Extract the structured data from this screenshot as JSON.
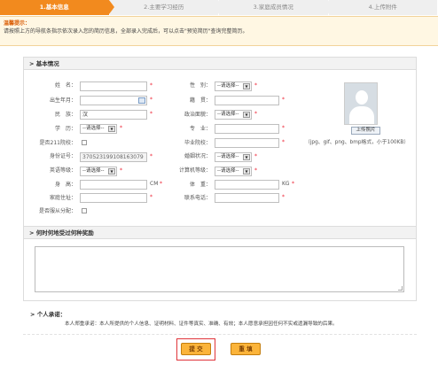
{
  "steps": [
    "1.基本信息",
    "2.主要学习经历",
    "3.家庭成员情况",
    "4.上传附件"
  ],
  "tip": {
    "title": "温馨提示：",
    "text": "请按照上方的导航条指示依次录入您的简历信息，全部录入完成后，可以点击\"预览简历\"查询完整简历。"
  },
  "basic": {
    "heading": "> 基本情况",
    "labels": {
      "name": "姓　名：",
      "birth": "出生年月：",
      "nation": "民　族：",
      "education": "学　历：",
      "is211": "是否211院校：",
      "idcard": "身份证号：",
      "english": "英语等级：",
      "height": "身　高：",
      "address": "家庭住址：",
      "assign": "是否服从分配：",
      "gender": "性　别：",
      "native": "籍　贯：",
      "political": "政治面貌：",
      "major": "专　业：",
      "school": "毕业院校：",
      "marital": "婚姻状况：",
      "computer": "计算机等级：",
      "weight": "体　重：",
      "phone": "联系电话："
    },
    "values": {
      "nation": "汉",
      "idcard": "370523199108163079",
      "select_default": "--请选择--",
      "height_unit": "CM",
      "weight_unit": "KG"
    },
    "required_mark": "*",
    "photo": {
      "upload_label": "上传照片",
      "hint": "（jpg、gif、png、bmp格式，小于100KB）"
    }
  },
  "awards": {
    "heading": "> 何时何地受过何种奖励"
  },
  "pledge": {
    "heading": "> 个人承诺：",
    "text": "本人郑重承诺：本人所提供的个人信息、证明材料、证件等真实、准确、有效；本人愿意承担因任何不实或遗漏导致的后果。"
  },
  "actions": {
    "submit": "提 交",
    "reset": "重 填"
  }
}
